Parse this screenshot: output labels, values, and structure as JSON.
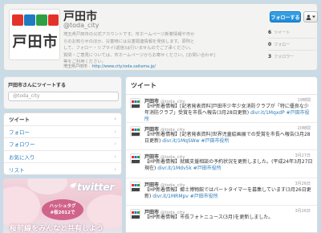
{
  "profile": {
    "logo_text": "TODA",
    "logo_kanji": "戸田市",
    "name": "戸田市",
    "handle": "@toda_city",
    "bio": [
      "埼玉県戸田市の公式アカウントです。市ホームページ新着情報や市か",
      "らのお知らせのほか、災害時には災害関連情報を発信します。原則と",
      "して、フォロー・リプライ(返信)は行いませんのでご了承ください。",
      "質問・ご意見については、市ホームページからお寄せください。[お問い合わせ]",
      "等をご利用ください。"
    ],
    "location": "埼玉県戸田市",
    "separator": "·",
    "url": "http://www.city.toda.saitama.jp/",
    "follow_label": "フォローする",
    "user_menu_icon": "person-icon",
    "stats": [
      {
        "num": "6",
        "label": "ツイート"
      },
      {
        "num": "0",
        "label": "フォロー"
      },
      {
        "num": "3",
        "label": "フォロワー"
      }
    ]
  },
  "tweet_box": {
    "title": "戸田市さんにツイートする",
    "placeholder": "@toda_city"
  },
  "nav": {
    "items": [
      {
        "label": "ツイート",
        "chevron": "›"
      },
      {
        "label": "フォロー",
        "chevron": "›"
      },
      {
        "label": "フォロワー",
        "chevron": "›"
      },
      {
        "label": "お気に入り",
        "chevron": "›"
      },
      {
        "label": "リスト",
        "chevron": "›"
      }
    ]
  },
  "banner": {
    "brand": "twitter",
    "hashtag_line1": "ハッシュタグ",
    "hashtag_line2": "#桜2012で",
    "caption": "桜前線をみんなと共有しよう"
  },
  "timeline": {
    "heading": "ツイート",
    "tweets": [
      {
        "name": "戸田市",
        "handle": "@toda_city",
        "time": "19時間",
        "text": "【HP新着情報】[記者発表資料]戸田市少年少女消防クラブが「特に優良な少年消防クラブ」受賞を市長へ報告(3月28日更新)",
        "link": "divr.it/1MqxdP",
        "tag": "#戸田市役所"
      },
      {
        "name": "戸田市",
        "handle": "@toda_city",
        "time": "20時間",
        "text": "【HP新着情報】[記者発表資料]世界児童絵画展での受賞を市長へ報告(3月28日更新)",
        "link": "divr.it/1MqSWw",
        "tag": "#戸田市役所"
      },
      {
        "name": "戸田市",
        "handle": "@toda_city",
        "time": "3月27日",
        "text": "【HP新着情報】就職支援相談の予約状況を更新しました。(平成24年3月27日現在)",
        "link": "divr.it/1Mdv5k",
        "tag": "#戸田市役所"
      },
      {
        "name": "戸田市",
        "handle": "@toda_city",
        "time": "3月26日",
        "text": "【HP新着情報】郷土博物館ではパートタイマーを募集しています(3月26日更新)",
        "link": "divr.it/1MRMpv",
        "tag": "#戸田市役所"
      },
      {
        "name": "戸田市",
        "handle": "@toda_city",
        "time": "3月26日",
        "text": "【HP新着情報】市長フォトニュース(3月)を更新しました。",
        "link": "",
        "tag": ""
      }
    ]
  },
  "colors": {
    "page_bg": "#c8dbe6",
    "link": "#2b7bb9",
    "follow_btn": "#1d8bd6",
    "logo_red": "#e4322b",
    "logo_blue": "#1f7ac0",
    "logo_green": "#2ea043"
  }
}
